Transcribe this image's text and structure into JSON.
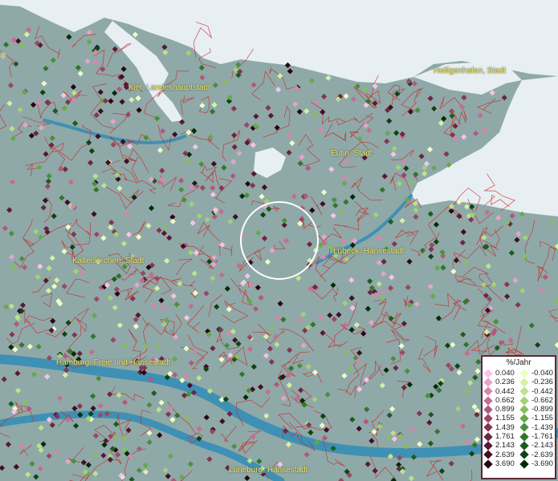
{
  "map": {
    "cities": [
      {
        "name": "Kiel, Landeshauptstadt"
      },
      {
        "name": "Heiligenhafen, Stadt"
      },
      {
        "name": "Eutin, Stadt"
      },
      {
        "name": "Lübeck, Hansestadt"
      },
      {
        "name": "Kaltenkirchen, Stadt"
      },
      {
        "name": "Hamburg, Freie und Hansestadt"
      },
      {
        "name": "Lüneburg, Hansestadt"
      }
    ],
    "colors": {
      "land": "#8fa9a8",
      "sea": "#e7eff3",
      "river": "#3f90b5",
      "boundaries": "#c82a2a",
      "label": "#f1e66a"
    }
  },
  "legend": {
    "title": "%/Jahr",
    "positive": [
      {
        "label": "0.040",
        "color": "#f7c3e8"
      },
      {
        "label": "0.236",
        "color": "#e5a4c9"
      },
      {
        "label": "0.442",
        "color": "#d686ac"
      },
      {
        "label": "0.662",
        "color": "#c46d92"
      },
      {
        "label": "0.899",
        "color": "#b05a7b"
      },
      {
        "label": "1.155",
        "color": "#9a4766"
      },
      {
        "label": "1.439",
        "color": "#833653"
      },
      {
        "label": "1.761",
        "color": "#6c2741"
      },
      {
        "label": "2.143",
        "color": "#561a31"
      },
      {
        "label": "2.639",
        "color": "#3e0f21"
      },
      {
        "label": "3.690",
        "color": "#280712"
      }
    ],
    "negative": [
      {
        "label": "-0.040",
        "color": "#effcc4"
      },
      {
        "label": "-0.236",
        "color": "#d6f0a5"
      },
      {
        "label": "-0.442",
        "color": "#bde28a"
      },
      {
        "label": "-0.662",
        "color": "#a2d274"
      },
      {
        "label": "-0.899",
        "color": "#85bf60"
      },
      {
        "label": "-1.155",
        "color": "#67a84d"
      },
      {
        "label": "-1.439",
        "color": "#4a903b"
      },
      {
        "label": "-1.761",
        "color": "#31762b"
      },
      {
        "label": "-2.143",
        "color": "#1d5c1e"
      },
      {
        "label": "-2.639",
        "color": "#0f4313"
      },
      {
        "label": "-3.690",
        "color": "#062b0a"
      }
    ]
  }
}
